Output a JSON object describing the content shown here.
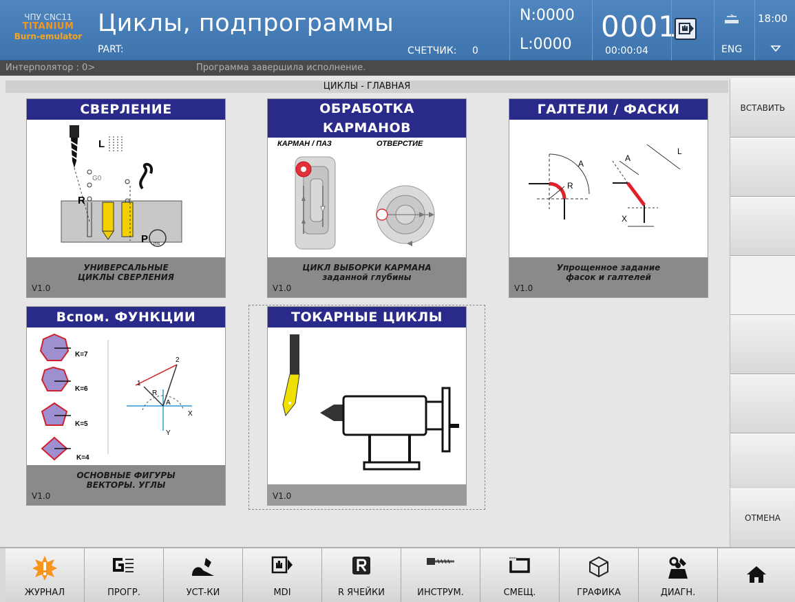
{
  "header": {
    "brand_line1": "ЧПУ CNC11",
    "brand_line2": "TITANIUM",
    "brand_line3": "Burn-emulator",
    "title": "Циклы, подпрограммы",
    "part_label": "PART:",
    "counter_label": "СЧЕТЧИК:",
    "counter_value": "0",
    "n_value": "N:0000",
    "l_value": "L:0000",
    "program_number": "0001",
    "program_time": "00:00:04",
    "language": "ENG",
    "clock": "18:00"
  },
  "status": {
    "interpolator": "Интерполятор : 0>",
    "message": "Программа завершила исполнение."
  },
  "section_title": "ЦИКЛЫ - ГЛАВНАЯ",
  "cards": {
    "drilling": {
      "title": "СВЕРЛЕНИЕ",
      "desc1": "УНИВЕРСАЛЬНЫЕ",
      "desc2": "ЦИКЛЫ  СВЕРЛЕНИЯ",
      "version": "V1.0",
      "lbl_l": "L",
      "lbl_g0": "G0",
      "lbl_r": "R",
      "lbl_p": "P",
      "lbl_ms": "ms"
    },
    "pockets": {
      "title1": "ОБРАБОТКА",
      "title2": "КАРМАНОВ",
      "sub1": "КАРМАН / ПАЗ",
      "sub2": "ОТВЕРСТИЕ",
      "desc1": "ЦИКЛ ВЫБОРКИ КАРМАНА",
      "desc2": "заданной глубины",
      "version": "V1.0"
    },
    "fillets": {
      "title": "ГАЛТЕЛИ / ФАСКИ",
      "desc1": "Упрощенное задание",
      "desc2": "фасок и галтелей",
      "version": "V1.0",
      "lbl_a": "A",
      "lbl_r": "R",
      "lbl_l": "L",
      "lbl_x": "X"
    },
    "aux": {
      "title": "Вспом. ФУНКЦИИ",
      "desc1": "ОСНОВНЫЕ ФИГУРЫ",
      "desc2": "ВЕКТОРЫ. УГЛЫ",
      "version": "V1.0",
      "k7": "K=7",
      "k6": "K=6",
      "k5": "K=5",
      "k4": "K=4",
      "lbl_1": "1",
      "lbl_2": "2",
      "lbl_r": "R",
      "lbl_a": "A",
      "lbl_x": "X",
      "lbl_y": "Y"
    },
    "turning": {
      "title": "ТОКАРНЫЕ  ЦИКЛЫ",
      "version": "V1.0"
    }
  },
  "softkeys": [
    "ВСТАВИТЬ",
    "",
    "",
    "",
    "",
    "",
    "",
    "ОТМЕНА"
  ],
  "bottom_buttons": [
    {
      "label": "ЖУРНАЛ",
      "icon": "warning-burst-icon"
    },
    {
      "label": "ПРОГР.",
      "icon": "program-g-icon"
    },
    {
      "label": "УСТ-КИ",
      "icon": "settings-tool-icon"
    },
    {
      "label": "MDI",
      "icon": "mdi-hand-icon"
    },
    {
      "label": "R ЯЧЕЙКИ",
      "icon": "r-cells-icon"
    },
    {
      "label": "ИНСТРУМ.",
      "icon": "drill-tool-icon"
    },
    {
      "label": "СМЕЩ.",
      "icon": "offset-frame-icon"
    },
    {
      "label": "ГРАФИКА",
      "icon": "cube-graphics-icon"
    },
    {
      "label": "ДИАГН.",
      "icon": "diagnostics-icon"
    }
  ],
  "home_icon": "home-icon",
  "colors": {
    "header_blue": "#4a80b8",
    "card_title": "#2a2a8a",
    "accent_orange": "#f7941d"
  }
}
